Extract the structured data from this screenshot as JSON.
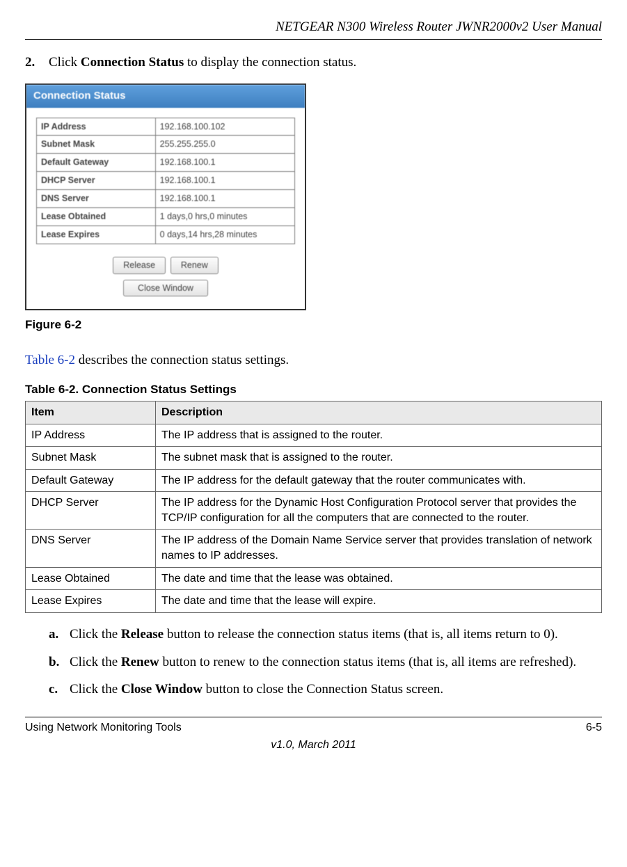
{
  "header": {
    "title": "NETGEAR N300 Wireless Router JWNR2000v2 User Manual"
  },
  "step2": {
    "num": "2.",
    "prefix": "Click ",
    "bold": "Connection Status",
    "suffix": " to display the connection status."
  },
  "screenshot": {
    "title": "Connection Status",
    "rows": [
      {
        "label": "IP Address",
        "value": "192.168.100.102"
      },
      {
        "label": "Subnet Mask",
        "value": "255.255.255.0"
      },
      {
        "label": "Default Gateway",
        "value": "192.168.100.1"
      },
      {
        "label": "DHCP Server",
        "value": "192.168.100.1"
      },
      {
        "label": "DNS Server",
        "value": "192.168.100.1"
      },
      {
        "label": "Lease Obtained",
        "value": "1 days,0 hrs,0 minutes"
      },
      {
        "label": "Lease Expires",
        "value": "0 days,14 hrs,28 minutes"
      }
    ],
    "buttons": {
      "release": "Release",
      "renew": "Renew",
      "close": "Close Window"
    }
  },
  "figure_caption": "Figure 6-2",
  "table_intro": {
    "link": "Table 6-2",
    "rest": " describes the connection status settings."
  },
  "table_title": "Table 6-2. Connection Status Settings",
  "table_headers": {
    "item": "Item",
    "desc": "Description"
  },
  "table_rows": [
    {
      "item": "IP Address",
      "desc": "The IP address that is assigned to the router."
    },
    {
      "item": "Subnet Mask",
      "desc": "The subnet mask that is assigned to the router."
    },
    {
      "item": "Default Gateway",
      "desc": "The IP address for the default gateway that the router communicates with."
    },
    {
      "item": "DHCP Server",
      "desc": "The IP address for the Dynamic Host Configuration Protocol server that provides the TCP/IP configuration for all the computers that are connected to the router."
    },
    {
      "item": "DNS Server",
      "desc": "The IP address of the Domain Name Service server that provides translation of network names to IP addresses."
    },
    {
      "item": "Lease Obtained",
      "desc": "The date and time that the lease was obtained."
    },
    {
      "item": "Lease Expires",
      "desc": "The date and time that the lease will expire."
    }
  ],
  "substeps": {
    "a": {
      "num": "a.",
      "p1": "Click the ",
      "b": "Release",
      "p2": " button to release the connection status items (that is, all items return to 0)."
    },
    "b": {
      "num": "b.",
      "p1": "Click the ",
      "b": "Renew",
      "p2": " button to renew to the connection status items (that is, all items are refreshed)."
    },
    "c": {
      "num": "c.",
      "p1": "Click the ",
      "b": "Close Window",
      "p2": " button to close the Connection Status screen."
    }
  },
  "footer": {
    "left": "Using Network Monitoring Tools",
    "right": "6-5",
    "center": "v1.0, March 2011"
  }
}
